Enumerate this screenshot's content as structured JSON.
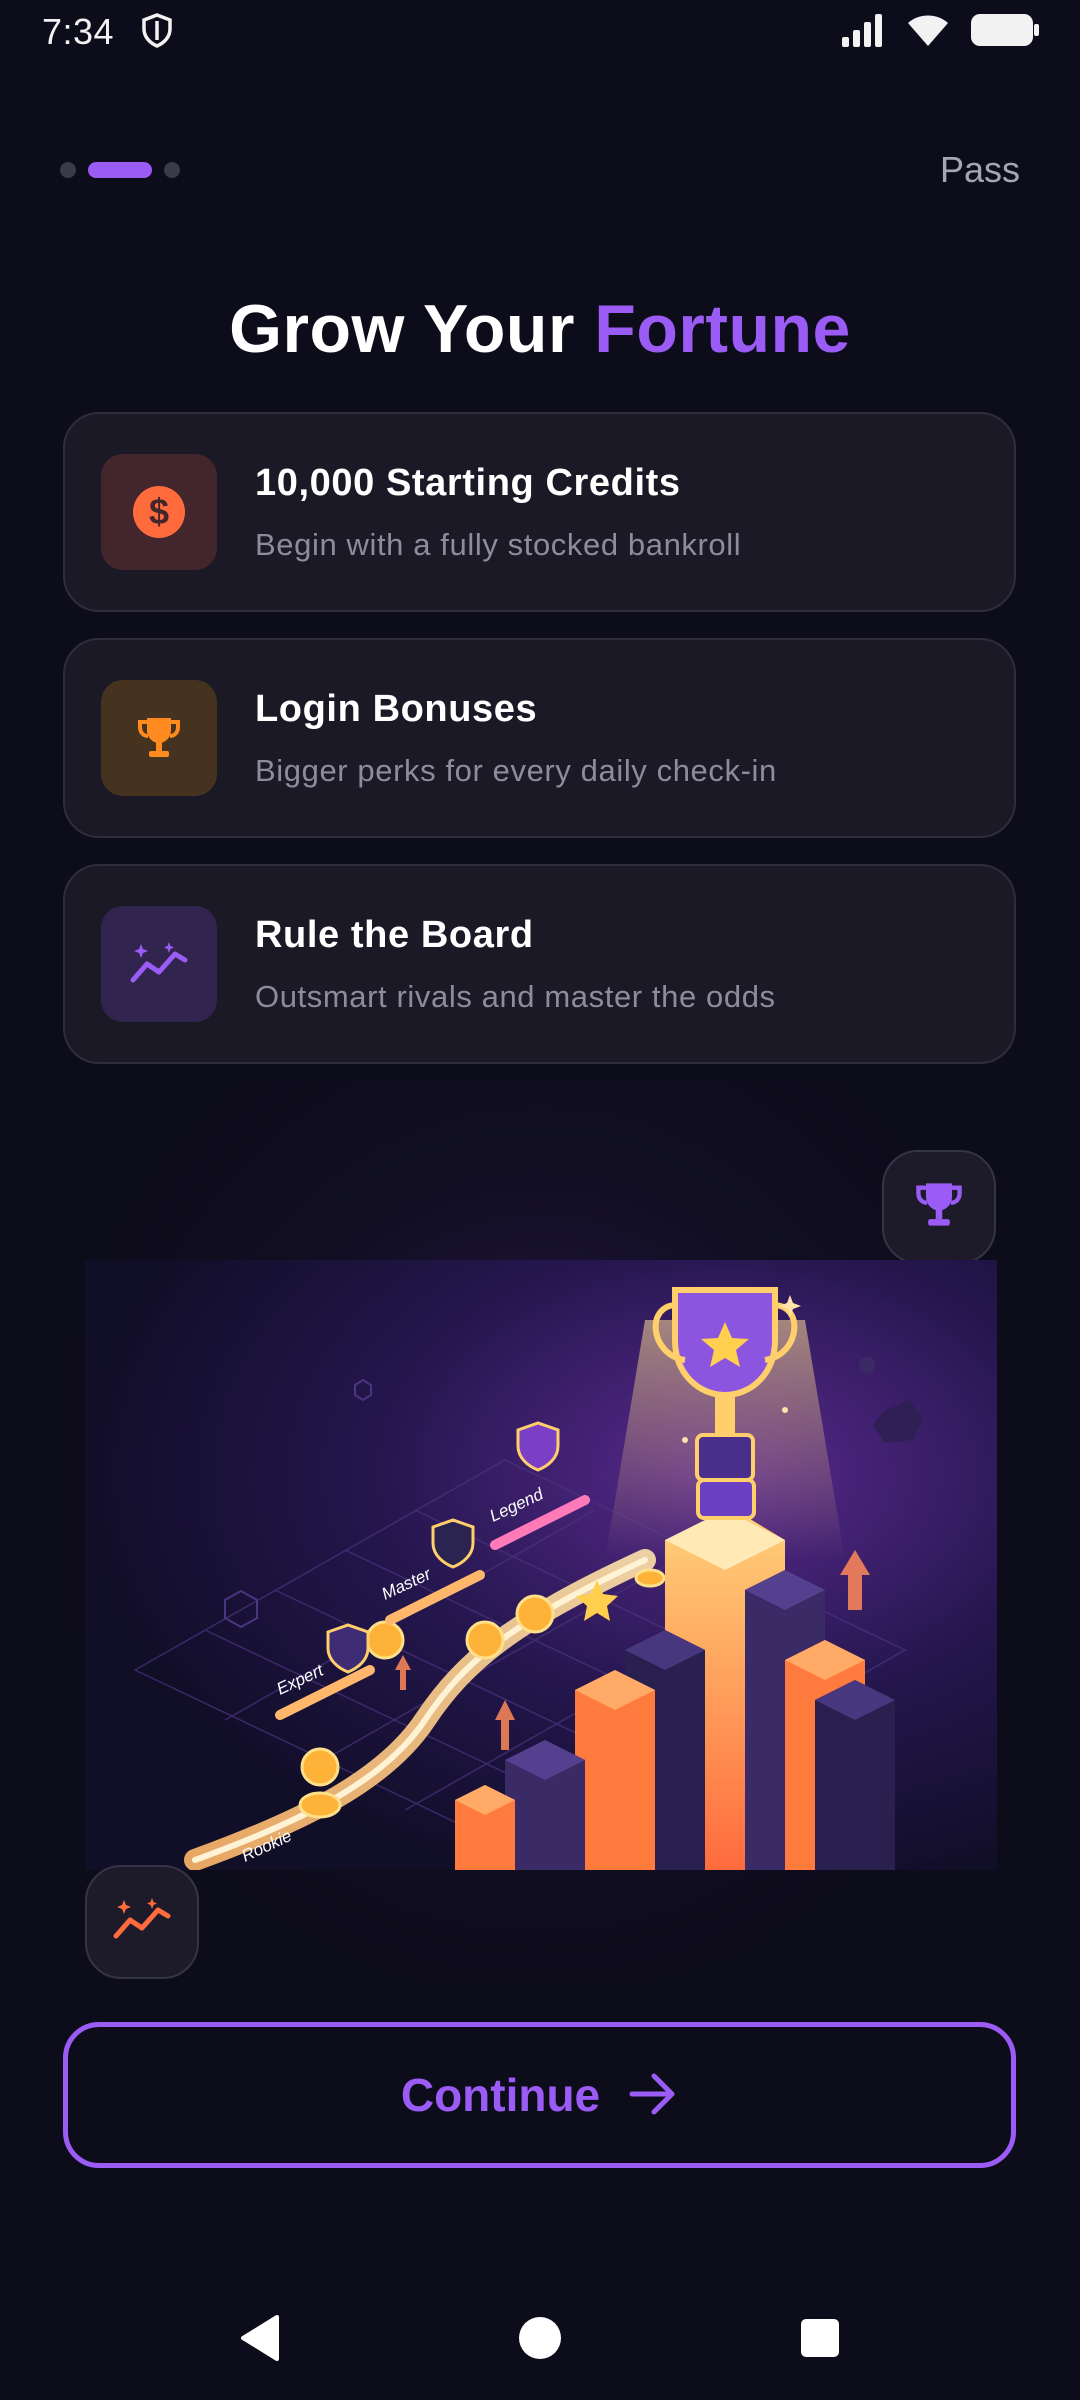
{
  "status_bar": {
    "time": "7:34"
  },
  "header": {
    "skip_label": "Pass",
    "page_index": 2,
    "page_count": 3
  },
  "headline": {
    "part1": "Grow Your ",
    "accent": "Fortune"
  },
  "features": [
    {
      "title": "10,000 Starting Credits",
      "description": "Begin with a fully stocked bankroll",
      "icon": "dollar-coin-icon",
      "icon_color": "#ff6b3d",
      "icon_bg": "#43262b"
    },
    {
      "title": "Login Bonuses",
      "description": "Bigger perks for every daily check-in",
      "icon": "trophy-icon",
      "icon_color": "#ff8a1f",
      "icon_bg": "#46331f"
    },
    {
      "title": "Rule the Board",
      "description": "Outsmart rivals and master the odds",
      "icon": "trend-sparkle-icon",
      "icon_color": "#9b5cf5",
      "icon_bg": "#31244f"
    }
  ],
  "illustration": {
    "tiers": [
      "Rookie",
      "Expert",
      "Master",
      "Legend"
    ]
  },
  "cta": {
    "label": "Continue"
  },
  "colors": {
    "accent": "#9b5cf5",
    "orange": "#ff6b3d",
    "background": "#0d0c1a",
    "card": "#1a1925"
  }
}
